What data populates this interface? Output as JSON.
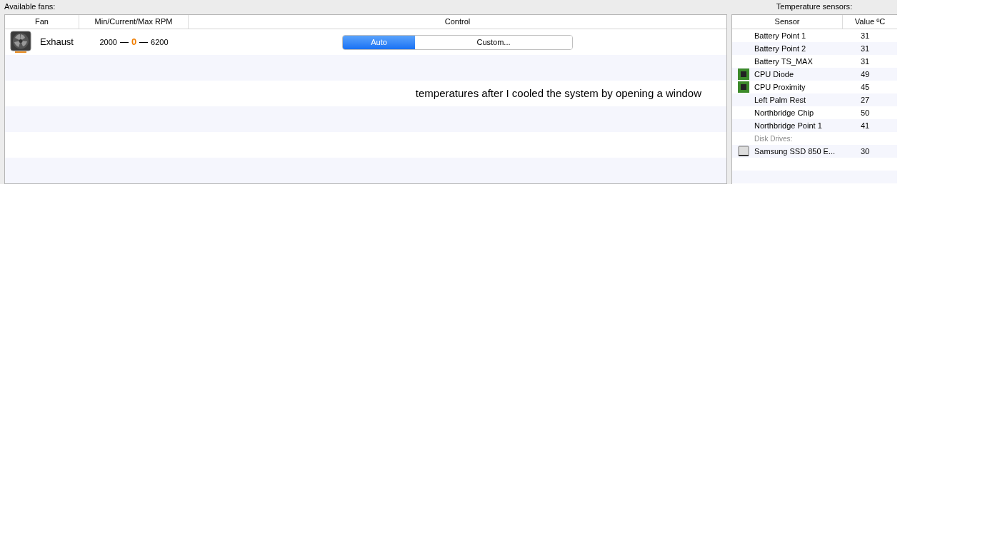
{
  "fans_panel": {
    "title": "Available fans:",
    "columns": [
      "Fan",
      "Min/Current/Max RPM",
      "Control"
    ],
    "fans": [
      {
        "name": "Exhaust",
        "min": "2000",
        "current": "0",
        "max": "6200",
        "control": [
          {
            "label": "Auto",
            "selected": true
          },
          {
            "label": "Custom...",
            "selected": false
          }
        ]
      }
    ],
    "note": "temperatures after I cooled the system by opening a window"
  },
  "sensors_panel": {
    "title": "Temperature sensors:",
    "columns": [
      "Sensor",
      "Value ºC"
    ],
    "sensors": [
      {
        "kind": "sensor",
        "name": "Battery Point 1",
        "value": "31"
      },
      {
        "kind": "sensor",
        "name": "Battery Point 2",
        "value": "31"
      },
      {
        "kind": "sensor",
        "name": "Battery TS_MAX",
        "value": "31"
      },
      {
        "kind": "cpu",
        "name": "CPU Diode",
        "value": "49"
      },
      {
        "kind": "cpu",
        "name": "CPU Proximity",
        "value": "45"
      },
      {
        "kind": "sensor",
        "name": "Left Palm Rest",
        "value": "27"
      },
      {
        "kind": "sensor",
        "name": "Northbridge Chip",
        "value": "50"
      },
      {
        "kind": "sensor",
        "name": "Northbridge Point 1",
        "value": "41"
      },
      {
        "kind": "group",
        "name": "Disk Drives:"
      },
      {
        "kind": "disk",
        "name": "Samsung SSD 850 E...",
        "value": "30"
      }
    ]
  }
}
